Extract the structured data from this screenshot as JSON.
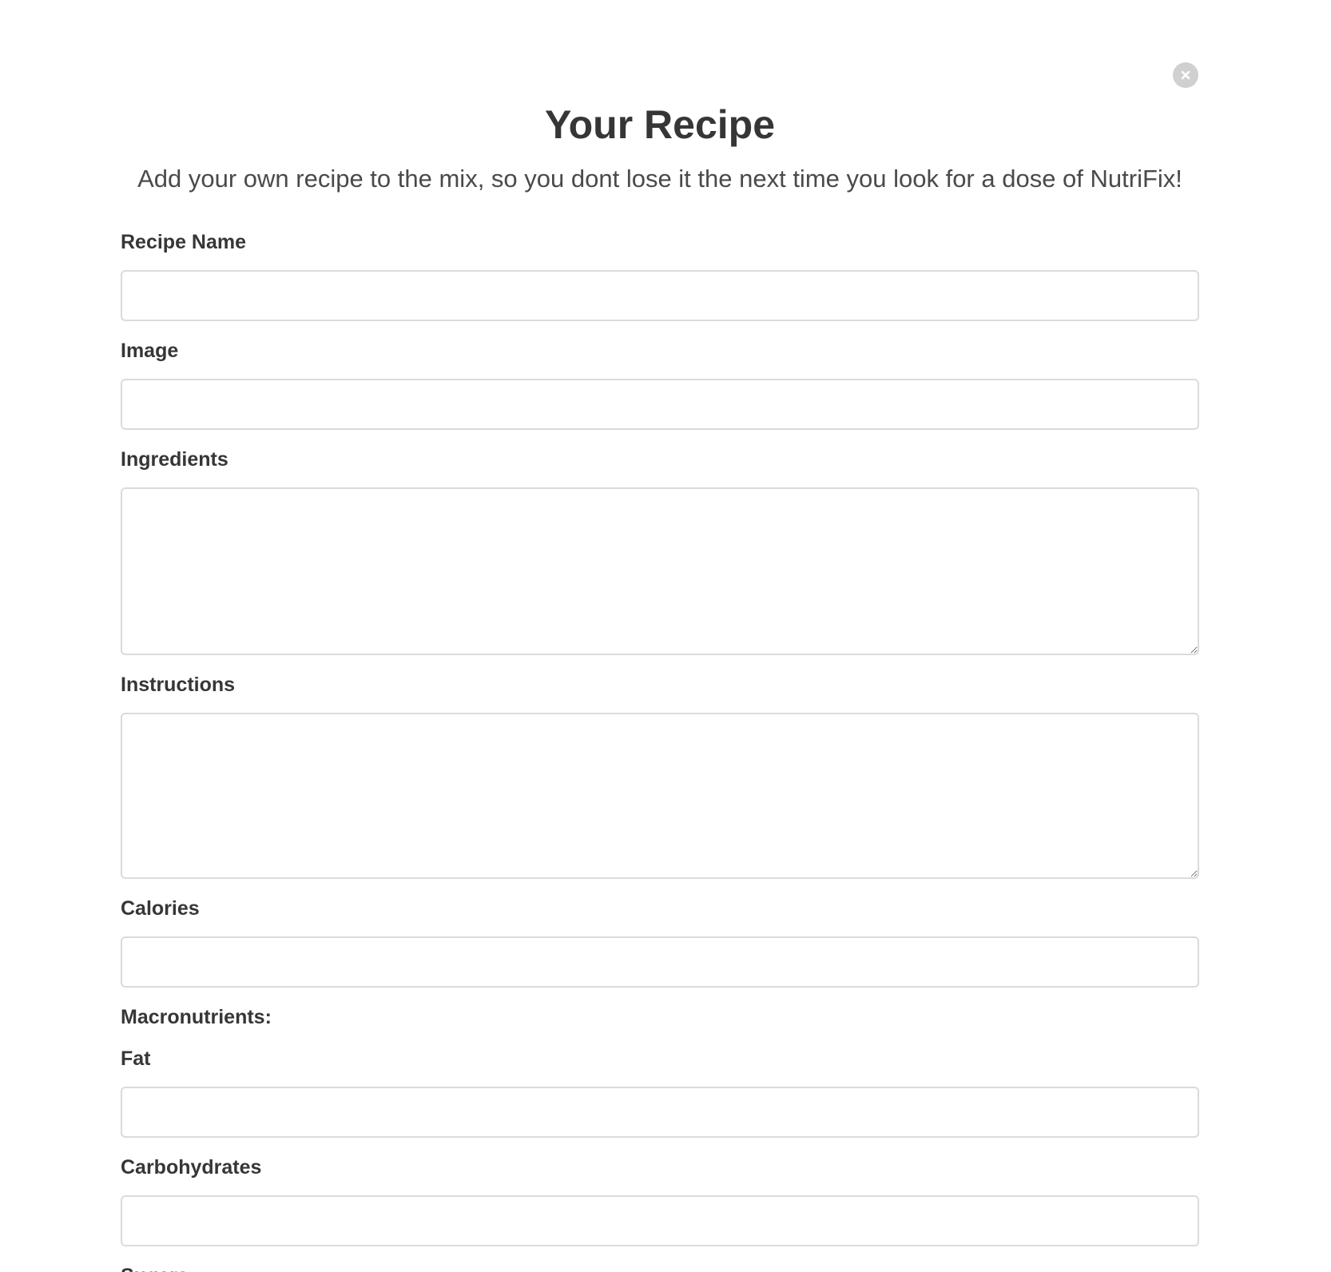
{
  "modal": {
    "title": "Your Recipe",
    "subtitle": "Add your own recipe to the mix, so you dont lose it the next time you look for a dose of NutriFix!",
    "close_icon": "close-icon"
  },
  "form": {
    "recipe_name": {
      "label": "Recipe Name",
      "value": ""
    },
    "image": {
      "label": "Image",
      "value": ""
    },
    "ingredients": {
      "label": "Ingredients",
      "value": ""
    },
    "instructions": {
      "label": "Instructions",
      "value": ""
    },
    "calories": {
      "label": "Calories",
      "value": ""
    },
    "macronutrients_heading": "Macronutrients:",
    "fat": {
      "label": "Fat",
      "value": ""
    },
    "carbohydrates": {
      "label": "Carbohydrates",
      "value": ""
    },
    "sugars": {
      "label": "Sugars"
    }
  },
  "colors": {
    "text": "#363636",
    "subtitle": "#4a4a4a",
    "input_border": "#dbdbdb",
    "close_button": "#d0d0d0"
  }
}
